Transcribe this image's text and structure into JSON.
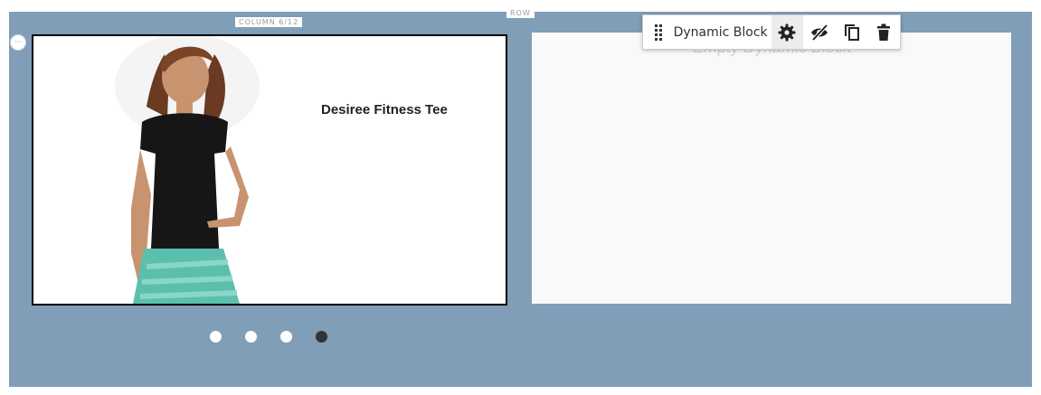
{
  "row": {
    "tag": "ROW"
  },
  "column": {
    "tag": "COLUMN 6/12",
    "handle_icon": "more-dots-icon"
  },
  "slider": {
    "product_title": "Desiree Fitness Tee",
    "dots": [
      {
        "active": false
      },
      {
        "active": false
      },
      {
        "active": false
      },
      {
        "active": true
      }
    ]
  },
  "dynamic_block": {
    "placeholder": "Empty Dynamic Block",
    "toolbar": {
      "label": "Dynamic Block",
      "icons": [
        "drag-handle-icon",
        "gear-icon",
        "eye-slash-icon",
        "copy-icon",
        "trash-icon"
      ]
    }
  },
  "colors": {
    "row_background": "#809eb7",
    "dot_active": "#333333",
    "dot_inactive": "#ffffff",
    "shirt": "#161616",
    "pants": "#5cbfad"
  }
}
